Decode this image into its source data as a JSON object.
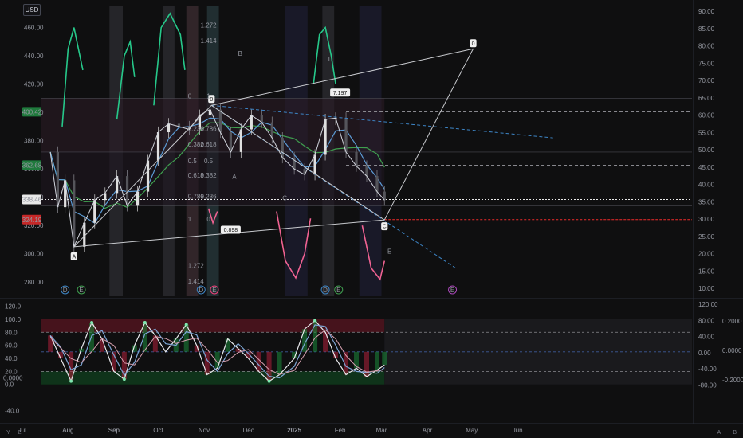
{
  "currency": "USD",
  "corner_left": [
    "Y",
    "Z"
  ],
  "corner_right": [
    "A",
    "B"
  ],
  "colors": {
    "bg": "#0f0f10",
    "price_line": "#d1d4dc",
    "ma_fast": "#5b9bd5",
    "ma_slow": "#3f9f4f",
    "osc_up": "#26c88a",
    "osc_down": "#f06292",
    "red_level": "#ef2b2b",
    "green_level": "#1fbf5a",
    "wave_line": "#c8cace",
    "trend_dash": "#3d85c6"
  },
  "chart_data": [
    {
      "type": "line",
      "panel": "price",
      "x_labels": [
        "Aug",
        "Sep",
        "Oct",
        "Nov",
        "Dec",
        "2025",
        "Feb",
        "Mar",
        "Apr",
        "May",
        "Jun",
        "Jul",
        "Aug",
        "Sep"
      ],
      "y_left_ticks": [
        280,
        300,
        320,
        340,
        360,
        380,
        400,
        420,
        440,
        460
      ],
      "y_right_ticks": [
        10,
        15,
        20,
        25,
        30,
        35,
        40,
        45,
        50,
        55,
        60,
        65,
        70,
        75,
        80,
        85,
        90
      ],
      "price_tags": [
        {
          "value": "400.42",
          "color": "#1f7a3c"
        },
        {
          "value": "362.68",
          "color": "#1f7a3c"
        },
        {
          "value": "338.46",
          "color": "#e8e8e8"
        },
        {
          "value": "324.19",
          "color": "#c62828"
        }
      ],
      "price_series": [
        {
          "d": "Jul 20",
          "v": 372
        },
        {
          "d": "Jul 25",
          "v": 333
        },
        {
          "d": "Jul 30",
          "v": 352
        },
        {
          "d": "Aug 5",
          "v": 305
        },
        {
          "d": "Aug 12",
          "v": 322
        },
        {
          "d": "Aug 19",
          "v": 338
        },
        {
          "d": "Aug 26",
          "v": 343
        },
        {
          "d": "Sep 3",
          "v": 355
        },
        {
          "d": "Sep 10",
          "v": 334
        },
        {
          "d": "Sep 17",
          "v": 344
        },
        {
          "d": "Sep 24",
          "v": 366
        },
        {
          "d": "Oct 1",
          "v": 386
        },
        {
          "d": "Oct 8",
          "v": 392
        },
        {
          "d": "Oct 15",
          "v": 390
        },
        {
          "d": "Oct 22",
          "v": 388
        },
        {
          "d": "Oct 29",
          "v": 398
        },
        {
          "d": "Nov 5",
          "v": 402
        },
        {
          "d": "Nov 12",
          "v": 386
        },
        {
          "d": "Nov 19",
          "v": 372
        },
        {
          "d": "Nov 26",
          "v": 388
        },
        {
          "d": "Dec 3",
          "v": 398
        },
        {
          "d": "Dec 10",
          "v": 393
        },
        {
          "d": "Dec 17",
          "v": 382
        },
        {
          "d": "Dec 24",
          "v": 368
        },
        {
          "d": "Jan 1",
          "v": 360
        },
        {
          "d": "Jan 8",
          "v": 356
        },
        {
          "d": "Jan 15",
          "v": 370
        },
        {
          "d": "Jan 22",
          "v": 395
        },
        {
          "d": "Jan 29",
          "v": 396
        },
        {
          "d": "Feb 5",
          "v": 372
        },
        {
          "d": "Feb 12",
          "v": 362
        },
        {
          "d": "Feb 19",
          "v": 355
        },
        {
          "d": "Feb 26",
          "v": 344
        },
        {
          "d": "Mar 3",
          "v": 338
        }
      ],
      "wave_labels": [
        "A",
        "B",
        "A",
        "C",
        "D",
        "E",
        "C",
        "D",
        "0"
      ],
      "fib_levels_left": [
        "0",
        "0.236",
        "0.382",
        "0.5",
        "0.618",
        "0.786",
        "1",
        "1.272",
        "1.414"
      ],
      "fib_levels_right": [
        "1",
        "0.786",
        "0.618",
        "0.5",
        "0.382",
        "0.236",
        "0",
        "1.272",
        "1.414"
      ],
      "fib_tags": [
        "7.197",
        "0.898"
      ],
      "event_markers": [
        "D",
        "E",
        "D",
        "E",
        "D",
        "E",
        "E"
      ]
    },
    {
      "type": "line",
      "panel": "oscillator",
      "y_left_ticks": [
        -40.0,
        0.0,
        20.0,
        40.0,
        60.0,
        80.0,
        100.0,
        120.0
      ],
      "y_left_extra": "0.0000",
      "y_right_ticks": [
        "120.00",
        "80.00",
        "40.00",
        "0.00",
        "-40.00",
        "-80.00"
      ],
      "y_far_right_ticks": [
        "0.2000",
        "0.0000",
        "-0.2000"
      ],
      "levels": [
        80,
        20,
        50
      ],
      "osc_series": [
        {
          "d": "Jul 20",
          "v": 75
        },
        {
          "d": "Jul 27",
          "v": 40
        },
        {
          "d": "Aug 3",
          "v": 5
        },
        {
          "d": "Aug 10",
          "v": 55
        },
        {
          "d": "Aug 17",
          "v": 95
        },
        {
          "d": "Aug 24",
          "v": 70
        },
        {
          "d": "Sep 1",
          "v": 20
        },
        {
          "d": "Sep 8",
          "v": 8
        },
        {
          "d": "Sep 15",
          "v": 60
        },
        {
          "d": "Sep 22",
          "v": 95
        },
        {
          "d": "Sep 29",
          "v": 75
        },
        {
          "d": "Oct 6",
          "v": 50
        },
        {
          "d": "Oct 13",
          "v": 70
        },
        {
          "d": "Oct 20",
          "v": 92
        },
        {
          "d": "Oct 27",
          "v": 60
        },
        {
          "d": "Nov 3",
          "v": 15
        },
        {
          "d": "Nov 10",
          "v": 25
        },
        {
          "d": "Nov 17",
          "v": 70
        },
        {
          "d": "Nov 24",
          "v": 55
        },
        {
          "d": "Dec 1",
          "v": 40
        },
        {
          "d": "Dec 8",
          "v": 20
        },
        {
          "d": "Dec 15",
          "v": 5
        },
        {
          "d": "Dec 22",
          "v": 15
        },
        {
          "d": "Jan 1",
          "v": 40
        },
        {
          "d": "Jan 8",
          "v": 85
        },
        {
          "d": "Jan 15",
          "v": 98
        },
        {
          "d": "Jan 22",
          "v": 80
        },
        {
          "d": "Jan 29",
          "v": 40
        },
        {
          "d": "Feb 5",
          "v": 15
        },
        {
          "d": "Feb 12",
          "v": 25
        },
        {
          "d": "Feb 19",
          "v": 12
        },
        {
          "d": "Feb 26",
          "v": 22
        },
        {
          "d": "Mar 3",
          "v": 30
        }
      ]
    }
  ]
}
